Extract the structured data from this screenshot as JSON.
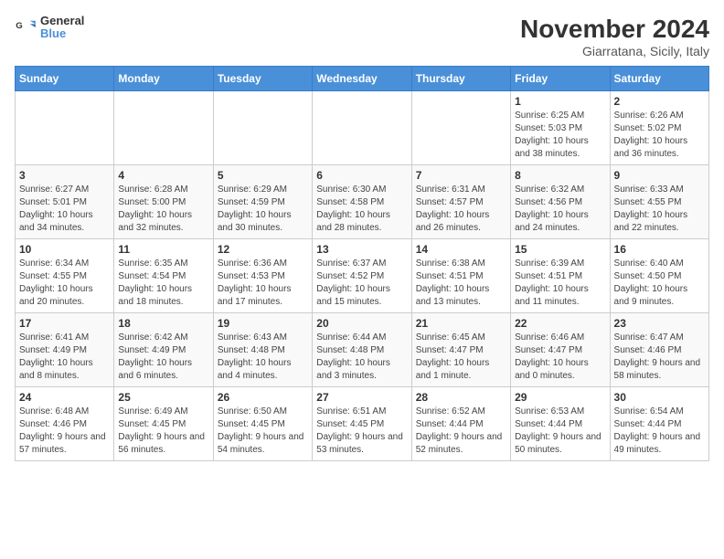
{
  "logo": {
    "line1": "General",
    "line2": "Blue"
  },
  "title": "November 2024",
  "subtitle": "Giarratana, Sicily, Italy",
  "headers": [
    "Sunday",
    "Monday",
    "Tuesday",
    "Wednesday",
    "Thursday",
    "Friday",
    "Saturday"
  ],
  "weeks": [
    [
      {
        "day": "",
        "detail": ""
      },
      {
        "day": "",
        "detail": ""
      },
      {
        "day": "",
        "detail": ""
      },
      {
        "day": "",
        "detail": ""
      },
      {
        "day": "",
        "detail": ""
      },
      {
        "day": "1",
        "detail": "Sunrise: 6:25 AM\nSunset: 5:03 PM\nDaylight: 10 hours and 38 minutes."
      },
      {
        "day": "2",
        "detail": "Sunrise: 6:26 AM\nSunset: 5:02 PM\nDaylight: 10 hours and 36 minutes."
      }
    ],
    [
      {
        "day": "3",
        "detail": "Sunrise: 6:27 AM\nSunset: 5:01 PM\nDaylight: 10 hours and 34 minutes."
      },
      {
        "day": "4",
        "detail": "Sunrise: 6:28 AM\nSunset: 5:00 PM\nDaylight: 10 hours and 32 minutes."
      },
      {
        "day": "5",
        "detail": "Sunrise: 6:29 AM\nSunset: 4:59 PM\nDaylight: 10 hours and 30 minutes."
      },
      {
        "day": "6",
        "detail": "Sunrise: 6:30 AM\nSunset: 4:58 PM\nDaylight: 10 hours and 28 minutes."
      },
      {
        "day": "7",
        "detail": "Sunrise: 6:31 AM\nSunset: 4:57 PM\nDaylight: 10 hours and 26 minutes."
      },
      {
        "day": "8",
        "detail": "Sunrise: 6:32 AM\nSunset: 4:56 PM\nDaylight: 10 hours and 24 minutes."
      },
      {
        "day": "9",
        "detail": "Sunrise: 6:33 AM\nSunset: 4:55 PM\nDaylight: 10 hours and 22 minutes."
      }
    ],
    [
      {
        "day": "10",
        "detail": "Sunrise: 6:34 AM\nSunset: 4:55 PM\nDaylight: 10 hours and 20 minutes."
      },
      {
        "day": "11",
        "detail": "Sunrise: 6:35 AM\nSunset: 4:54 PM\nDaylight: 10 hours and 18 minutes."
      },
      {
        "day": "12",
        "detail": "Sunrise: 6:36 AM\nSunset: 4:53 PM\nDaylight: 10 hours and 17 minutes."
      },
      {
        "day": "13",
        "detail": "Sunrise: 6:37 AM\nSunset: 4:52 PM\nDaylight: 10 hours and 15 minutes."
      },
      {
        "day": "14",
        "detail": "Sunrise: 6:38 AM\nSunset: 4:51 PM\nDaylight: 10 hours and 13 minutes."
      },
      {
        "day": "15",
        "detail": "Sunrise: 6:39 AM\nSunset: 4:51 PM\nDaylight: 10 hours and 11 minutes."
      },
      {
        "day": "16",
        "detail": "Sunrise: 6:40 AM\nSunset: 4:50 PM\nDaylight: 10 hours and 9 minutes."
      }
    ],
    [
      {
        "day": "17",
        "detail": "Sunrise: 6:41 AM\nSunset: 4:49 PM\nDaylight: 10 hours and 8 minutes."
      },
      {
        "day": "18",
        "detail": "Sunrise: 6:42 AM\nSunset: 4:49 PM\nDaylight: 10 hours and 6 minutes."
      },
      {
        "day": "19",
        "detail": "Sunrise: 6:43 AM\nSunset: 4:48 PM\nDaylight: 10 hours and 4 minutes."
      },
      {
        "day": "20",
        "detail": "Sunrise: 6:44 AM\nSunset: 4:48 PM\nDaylight: 10 hours and 3 minutes."
      },
      {
        "day": "21",
        "detail": "Sunrise: 6:45 AM\nSunset: 4:47 PM\nDaylight: 10 hours and 1 minute."
      },
      {
        "day": "22",
        "detail": "Sunrise: 6:46 AM\nSunset: 4:47 PM\nDaylight: 10 hours and 0 minutes."
      },
      {
        "day": "23",
        "detail": "Sunrise: 6:47 AM\nSunset: 4:46 PM\nDaylight: 9 hours and 58 minutes."
      }
    ],
    [
      {
        "day": "24",
        "detail": "Sunrise: 6:48 AM\nSunset: 4:46 PM\nDaylight: 9 hours and 57 minutes."
      },
      {
        "day": "25",
        "detail": "Sunrise: 6:49 AM\nSunset: 4:45 PM\nDaylight: 9 hours and 56 minutes."
      },
      {
        "day": "26",
        "detail": "Sunrise: 6:50 AM\nSunset: 4:45 PM\nDaylight: 9 hours and 54 minutes."
      },
      {
        "day": "27",
        "detail": "Sunrise: 6:51 AM\nSunset: 4:45 PM\nDaylight: 9 hours and 53 minutes."
      },
      {
        "day": "28",
        "detail": "Sunrise: 6:52 AM\nSunset: 4:44 PM\nDaylight: 9 hours and 52 minutes."
      },
      {
        "day": "29",
        "detail": "Sunrise: 6:53 AM\nSunset: 4:44 PM\nDaylight: 9 hours and 50 minutes."
      },
      {
        "day": "30",
        "detail": "Sunrise: 6:54 AM\nSunset: 4:44 PM\nDaylight: 9 hours and 49 minutes."
      }
    ]
  ]
}
